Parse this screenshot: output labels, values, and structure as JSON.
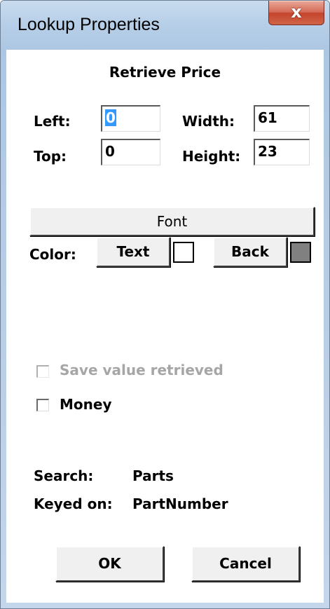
{
  "window": {
    "title": "Lookup Properties",
    "close_glyph": "x"
  },
  "dialog": {
    "caption": "Retrieve Price",
    "fields": {
      "left_label": "Left:",
      "left_value": "0",
      "top_label": "Top:",
      "top_value": "0",
      "width_label": "Width:",
      "width_value": "61",
      "height_label": "Height:",
      "height_value": "23"
    },
    "font_button": "Font",
    "color": {
      "label": "Color:",
      "text_button": "Text",
      "text_swatch_color": "#ffffff",
      "back_button": "Back",
      "back_swatch_color": "#808080"
    },
    "checkboxes": {
      "save_value_label": "Save value retrieved",
      "save_value_checked": false,
      "save_value_enabled": false,
      "money_label": "Money",
      "money_checked": false
    },
    "info": {
      "search_label": "Search:",
      "search_value": "Parts",
      "keyed_label": "Keyed on:",
      "keyed_value": "PartNumber"
    },
    "ok_button": "OK",
    "cancel_button": "Cancel"
  }
}
